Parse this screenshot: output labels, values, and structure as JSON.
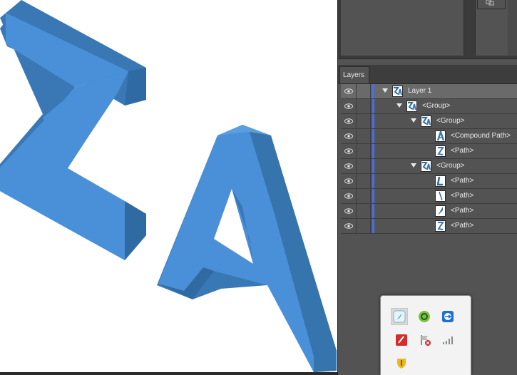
{
  "panel": {
    "tab_label": "Layers"
  },
  "layers": [
    {
      "label": "Layer 1",
      "depth": 0,
      "expanded": true,
      "selected": true,
      "thumb": "za-icon"
    },
    {
      "label": "<Group>",
      "depth": 1,
      "expanded": true,
      "selected": false,
      "thumb": "za-icon"
    },
    {
      "label": "<Group>",
      "depth": 2,
      "expanded": true,
      "selected": false,
      "thumb": "za-icon"
    },
    {
      "label": "<Compound Path>",
      "depth": 3,
      "expanded": null,
      "selected": false,
      "thumb": "a-icon"
    },
    {
      "label": "<Path>",
      "depth": 3,
      "expanded": null,
      "selected": false,
      "thumb": "z-icon"
    },
    {
      "label": "<Group>",
      "depth": 2,
      "expanded": true,
      "selected": false,
      "thumb": "za-icon"
    },
    {
      "label": "<Path>",
      "depth": 3,
      "expanded": null,
      "selected": false,
      "thumb": "path-l-icon"
    },
    {
      "label": "<Path>",
      "depth": 3,
      "expanded": null,
      "selected": false,
      "thumb": "path-slash-icon"
    },
    {
      "label": "<Path>",
      "depth": 3,
      "expanded": null,
      "selected": false,
      "thumb": "path-leaf-icon"
    },
    {
      "label": "<Path>",
      "depth": 3,
      "expanded": null,
      "selected": false,
      "thumb": "z-icon"
    }
  ],
  "colors": {
    "letter_face": "#4a90d9",
    "letter_side": "#3a78b5",
    "layer_color": "#4a6ee0"
  },
  "tray_icons": [
    "feather-icon",
    "sync-icon",
    "teamviewer-icon",
    "adobe-red-icon",
    "flag-error-icon",
    "signal-icon",
    "shield-icon"
  ]
}
